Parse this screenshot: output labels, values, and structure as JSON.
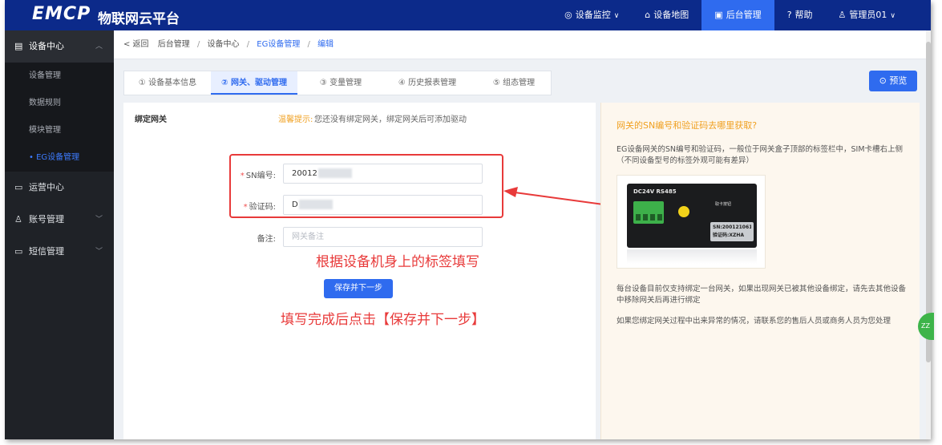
{
  "header": {
    "logo": "EMCP",
    "title": "物联网云平台",
    "nav": [
      {
        "icon": "device-monitor-icon",
        "glyph": "◎",
        "label": "设备监控",
        "caret": true,
        "active": false
      },
      {
        "icon": "device-map-icon",
        "glyph": "⌂",
        "label": "设备地图",
        "caret": false,
        "active": false
      },
      {
        "icon": "backend-admin-icon",
        "glyph": "▣",
        "label": "后台管理",
        "caret": false,
        "active": true
      },
      {
        "icon": "help-icon",
        "glyph": "?",
        "label": "帮助",
        "caret": false,
        "active": false
      },
      {
        "icon": "user-icon",
        "glyph": "♙",
        "label": "管理员01",
        "caret": true,
        "active": false
      }
    ]
  },
  "sidebar": {
    "groups": [
      {
        "label": "设备中心",
        "icon": "device-center-icon",
        "open": true
      },
      {
        "label": "运营中心",
        "icon": "operation-center-icon",
        "open": false
      },
      {
        "label": "账号管理",
        "icon": "account-icon",
        "open": false
      },
      {
        "label": "短信管理",
        "icon": "sms-icon",
        "open": false
      }
    ],
    "sub_items": [
      {
        "label": "设备管理",
        "active": false
      },
      {
        "label": "数据规则",
        "active": false
      },
      {
        "label": "模块管理",
        "active": false
      },
      {
        "label": "• EG设备管理",
        "active": true
      }
    ]
  },
  "breadcrumb": {
    "back": "< 返回",
    "items": [
      "后台管理",
      "设备中心",
      "EG设备管理",
      "编辑"
    ],
    "sep": "/"
  },
  "tabs": [
    {
      "label": "① 设备基本信息",
      "active": false
    },
    {
      "label": "② 网关、驱动管理",
      "active": true
    },
    {
      "label": "③ 变量管理",
      "active": false
    },
    {
      "label": "④ 历史报表管理",
      "active": false
    },
    {
      "label": "⑤ 组态管理",
      "active": false
    }
  ],
  "preview_button": "⊙ 预览",
  "form": {
    "card_title": "绑定网关",
    "tip_label": "温馨提示:",
    "tip_text": "您还没有绑定网关，绑定网关后可添加驱动",
    "sn_label": "SN编号:",
    "sn_value": "20012",
    "code_label": "验证码:",
    "code_value": "D",
    "remark_label": "备注:",
    "remark_placeholder": "网关备注",
    "required_mark": "*",
    "save_button": "保存并下一步"
  },
  "annotations": {
    "note1": "根据设备机身上的标签填写",
    "note2": "填写完成后点击【保存并下一步】",
    "colors": {
      "highlight": "#e83a3a"
    }
  },
  "help": {
    "question": "网关的SN编号和验证码去哪里获取?",
    "para1": "EG设备网关的SN编号和验证码，一般位于网关盒子顶部的标签栏中，SIM卡槽右上侧（不同设备型号的标签外观可能有差异）",
    "para2": "每台设备目前仅支持绑定一台网关，如果出现网关已被其他设备绑定，请先去其他设备中移除网关后再进行绑定",
    "para3": "如果您绑定网关过程中出来异常的情况，请联系您的售后人员或商务人员为您处理",
    "device_label": "DC24V  RS485",
    "device_small": "取卡按钮",
    "plate_sn": "SN:20012106127",
    "plate_code": "验证码:XZHA"
  },
  "floating_badge": "ZZ",
  "theme": {
    "primary": "#2f6bef",
    "header_bg": "#0c2a8a",
    "sidebar_bg": "#1f2227",
    "warning": "#f0a020"
  }
}
